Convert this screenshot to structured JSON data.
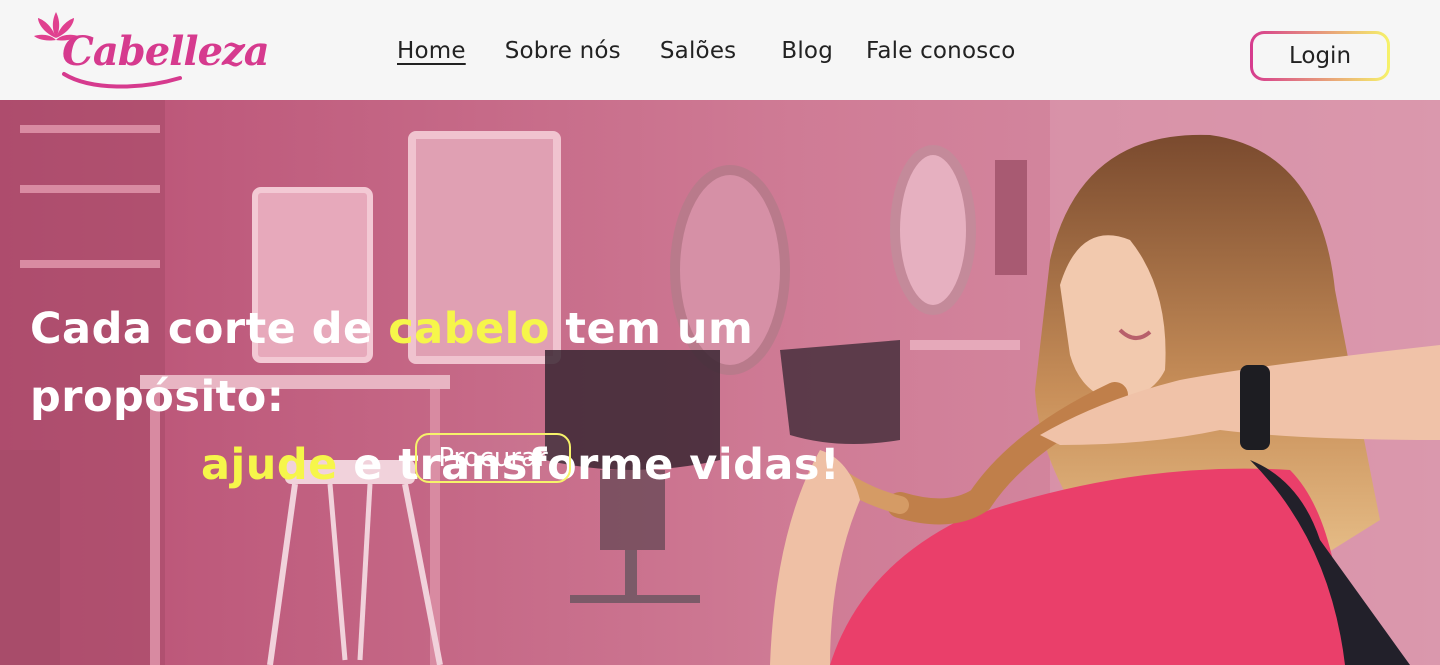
{
  "brand": {
    "name": "Cabelleza",
    "color": "#d63a8e"
  },
  "nav": {
    "items": [
      {
        "label": "Home"
      },
      {
        "label": "Sobre nós"
      },
      {
        "label": "Salões"
      },
      {
        "label": "Blog"
      },
      {
        "label": "Fale conosco"
      }
    ],
    "login_label": "Login"
  },
  "hero": {
    "line1_a": "Cada corte de ",
    "line1_b": "cabelo",
    "line1_c": " tem um propósito:",
    "line2_a": "ajude",
    "line2_b": " e transforme vidas!",
    "button_label": "Procurar",
    "highlight_color": "#f6f64a",
    "overlay_color": "#c85d7f"
  }
}
